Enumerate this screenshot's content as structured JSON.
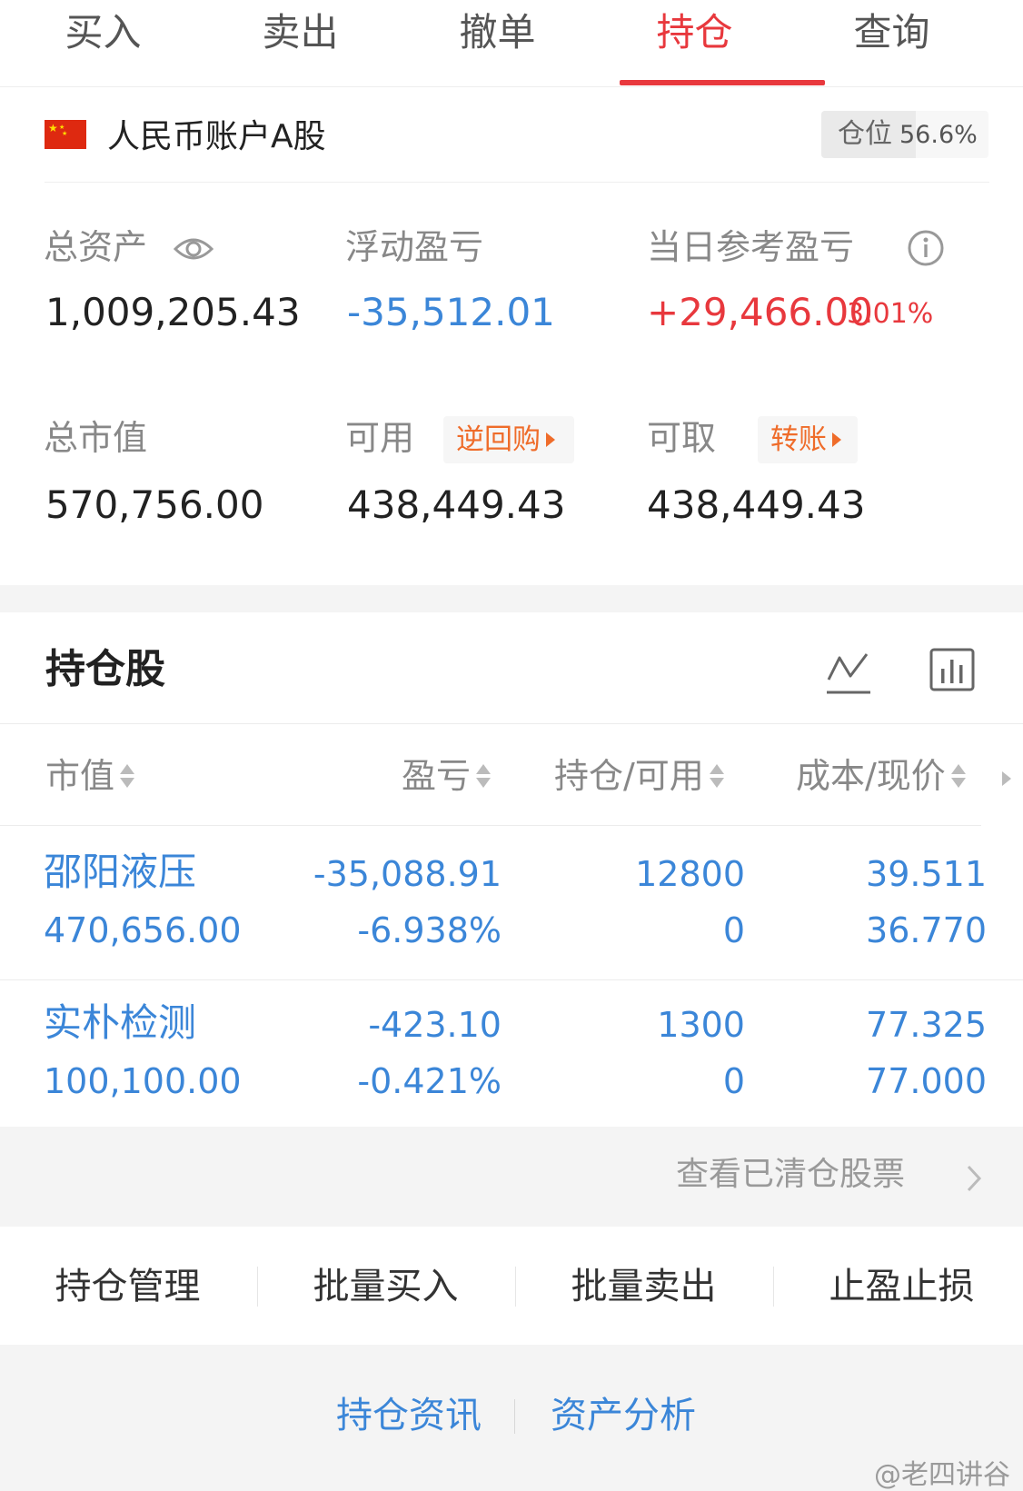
{
  "tabs": [
    "买入",
    "卖出",
    "撤单",
    "持仓",
    "查询"
  ],
  "active_tab": "持仓",
  "account": {
    "name": "人民币账户A股",
    "position_label": "仓位",
    "position_value": "56.6%",
    "position_fraction": 0.566
  },
  "summary": {
    "total_assets_label": "总资产",
    "total_assets": "1,009,205.43",
    "floating_pl_label": "浮动盈亏",
    "floating_pl": "-35,512.01",
    "daily_pl_label": "当日参考盈亏",
    "daily_pl": "+29,466.00",
    "daily_pl_pct": "3.01%",
    "market_value_label": "总市值",
    "market_value": "570,756.00",
    "available_label": "可用",
    "available": "438,449.43",
    "reverse_repo_label": "逆回购",
    "withdrawable_label": "可取",
    "withdrawable": "438,449.43",
    "transfer_label": "转账"
  },
  "holdings": {
    "title": "持仓股",
    "columns": [
      "市值",
      "盈亏",
      "持仓/可用",
      "成本/现价"
    ],
    "rows": [
      {
        "name": "邵阳液压",
        "market_value": "470,656.00",
        "pl": "-35,088.91",
        "pl_pct": "-6.938%",
        "qty": "12800",
        "available": "0",
        "cost": "39.511",
        "price": "36.770"
      },
      {
        "name": "实朴检测",
        "market_value": "100,100.00",
        "pl": "-423.10",
        "pl_pct": "-0.421%",
        "qty": "1300",
        "available": "0",
        "cost": "77.325",
        "price": "77.000"
      }
    ],
    "cleared_link": "查看已清仓股票"
  },
  "actions": [
    "持仓管理",
    "批量买入",
    "批量卖出",
    "止盈止损"
  ],
  "bottom_links": [
    "持仓资讯",
    "资产分析"
  ],
  "watermark": "@老四讲谷",
  "icons": {
    "eye": "eye-icon",
    "info": "info-icon",
    "trend": "trend-line-icon",
    "bars": "bar-chart-icon",
    "sort": "sort-icon",
    "chevron": "chevron-right-icon",
    "flag": "china-flag-icon"
  },
  "colors": {
    "accent_red": "#e8383d",
    "link_blue": "#3b86d8",
    "tag_orange": "#ef6c2a"
  }
}
